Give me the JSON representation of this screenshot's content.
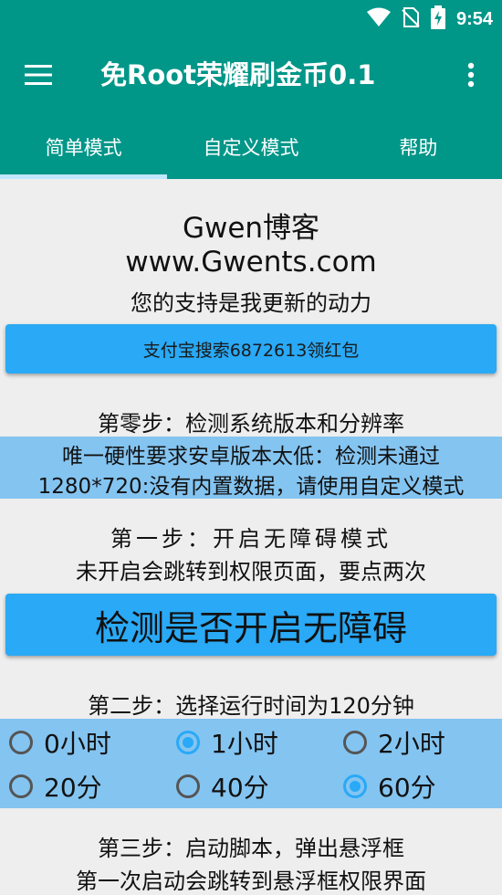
{
  "status_bar": {
    "time": "9:54",
    "icons": [
      "wifi-icon",
      "no-sim-icon",
      "battery-charging-icon"
    ]
  },
  "toolbar": {
    "title": "免Root荣耀刷金币0.1",
    "menu_icon": "hamburger-menu-icon",
    "overflow_icon": "more-vertical-icon"
  },
  "tabs": [
    {
      "label": "简单模式",
      "active": true
    },
    {
      "label": "自定义模式",
      "active": false
    },
    {
      "label": "帮助",
      "active": false
    }
  ],
  "blog": {
    "title": "Gwen博客",
    "url": "www.Gwents.com",
    "subtitle": "您的支持是我更新的动力"
  },
  "donate_button": "支付宝搜索6872613领红包",
  "step0": {
    "title": "第零步：检测系统版本和分辨率",
    "info_line1": "唯一硬性要求安卓版本太低：检测未通过",
    "info_line2": "1280*720:没有内置数据，请使用自定义模式"
  },
  "step1": {
    "title": "第一步：开启无障碍模式",
    "subtitle": "未开启会跳转到权限页面，要点两次",
    "button": "检测是否开启无障碍"
  },
  "step2": {
    "title": "第二步：选择运行时间为120分钟",
    "options": [
      {
        "label": "0小时",
        "checked": false
      },
      {
        "label": "1小时",
        "checked": true
      },
      {
        "label": "2小时",
        "checked": false
      },
      {
        "label": "20分",
        "checked": false
      },
      {
        "label": "40分",
        "checked": false
      },
      {
        "label": "60分",
        "checked": true
      }
    ]
  },
  "step3": {
    "title": "第三步：启动脚本，弹出悬浮框",
    "subtitle": "第一次启动会跳转到悬浮框权限界面"
  },
  "colors": {
    "app_bar": "#009688",
    "accent": "#29a9f6",
    "info_background": "#84c4f1",
    "tab_indicator": "#bfe8ff",
    "background": "#eeeeee"
  }
}
